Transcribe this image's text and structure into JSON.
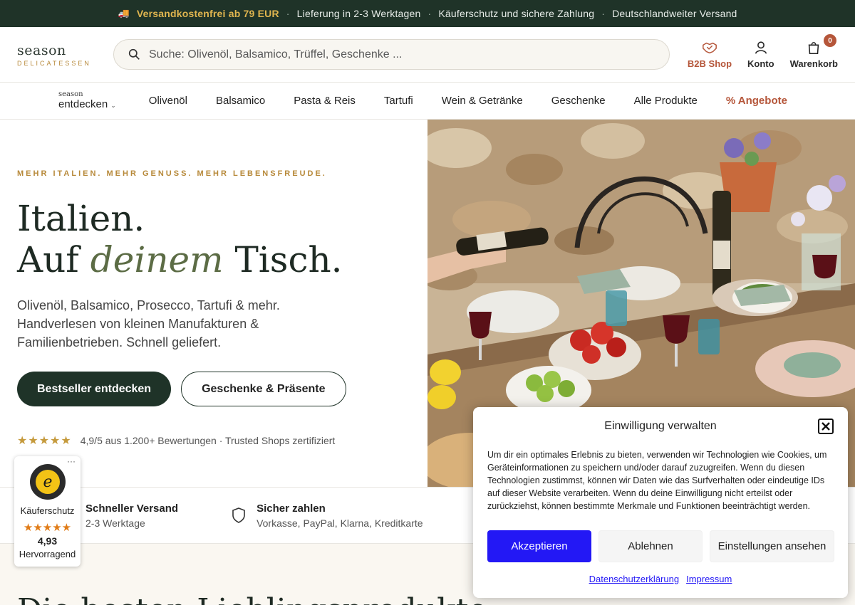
{
  "topbar": {
    "free_shipping": "Versandkostenfrei ab 79 EUR",
    "delivery": "Lieferung in 2-3 Werktagen",
    "protection": "Käuferschutz und sichere Zahlung",
    "nationwide": "Deutschlandweiter Versand",
    "separator": "·",
    "truck_icon": "truck-icon"
  },
  "header": {
    "logo_main": "season",
    "logo_sub": "DELICATESSEN",
    "search_placeholder": "Suche: Olivenöl, Balsamico, Trüffel, Geschenke ...",
    "b2b_label": "B2B Shop",
    "account_label": "Konto",
    "cart_label": "Warenkorb",
    "cart_count": "0"
  },
  "nav": {
    "discover_small": "season",
    "discover_big": "entdecken",
    "discover_chevron": "⌄",
    "items": [
      "Olivenöl",
      "Balsamico",
      "Pasta & Reis",
      "Tartufi",
      "Wein & Getränke",
      "Geschenke",
      "Alle Produkte",
      "% Angebote"
    ]
  },
  "hero": {
    "eyebrow": "MEHR ITALIEN. MEHR GENUSS. MEHR LEBENSFREUDE.",
    "title_line1": "Italien.",
    "title_auf": "Auf",
    "title_deinem": "deinem",
    "title_tisch": "Tisch.",
    "subtitle": "Olivenöl, Balsamico, Prosecco, Tartufi & mehr. Handverlesen von kleinen Manufakturen & Familienbetrieben. Schnell geliefert.",
    "btn_primary": "Bestseller entdecken",
    "btn_secondary": "Geschenke & Präsente",
    "stars": "★★★★★",
    "rating_text": "4,9/5 aus 1.200+ Bewertungen · Trusted Shops zertifiziert"
  },
  "features": [
    {
      "title": "Schneller Versand",
      "sub": "2-3 Werktage"
    },
    {
      "title": "Sicher zahlen",
      "sub": "Vorkasse, PayPal, Klarna, Kreditkarte"
    }
  ],
  "section": {
    "title": "Die besten Lieblingsprodukte"
  },
  "trusted_shops": {
    "label": "Käuferschutz",
    "stars": "★★★★★",
    "score": "4,93",
    "verdict": "Hervorragend",
    "menu": "···",
    "seal_letter": "e"
  },
  "consent": {
    "title": "Einwilligung verwalten",
    "text": "Um dir ein optimales Erlebnis zu bieten, verwenden wir Technologien wie Cookies, um Geräteinformationen zu speichern und/oder darauf zuzugreifen. Wenn du diesen Technologien zustimmst, können wir Daten wie das Surfverhalten oder eindeutige IDs auf dieser Website verarbeiten. Wenn du deine Einwilligung nicht erteilst oder zurückziehst, können bestimmte Merkmale und Funktionen beeinträchtigt werden.",
    "accept": "Akzeptieren",
    "deny": "Ablehnen",
    "settings": "Einstellungen ansehen",
    "privacy_link": "Datenschutzerklärung",
    "imprint_link": "Impressum"
  },
  "colors": {
    "topbar_bg": "#1f3328",
    "accent_gold": "#b7893a",
    "accent_terracotta": "#b5563a",
    "consent_accept": "#2318f5"
  }
}
